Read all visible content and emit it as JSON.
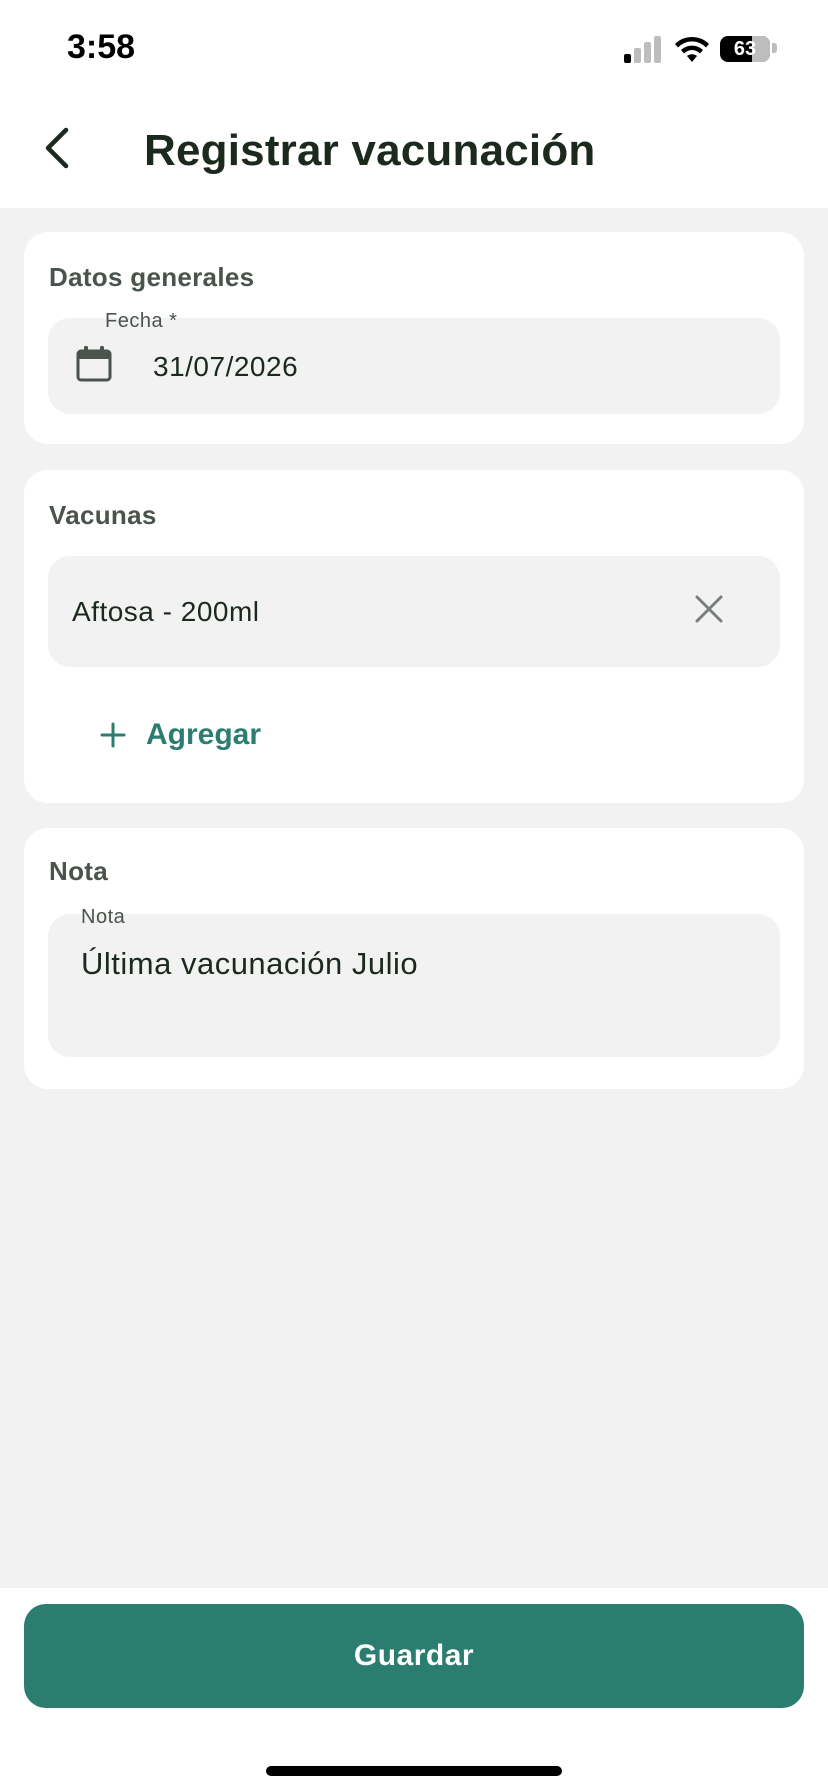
{
  "status_bar": {
    "time": "3:58",
    "battery_percent": "63",
    "battery_level": 0.63
  },
  "header": {
    "back_icon": "chevron-left-icon",
    "title": "Registrar vacunación"
  },
  "general_section": {
    "title": "Datos generales",
    "date_field": {
      "label": "Fecha *",
      "value": "31/07/2026",
      "icon": "calendar-icon"
    }
  },
  "vaccines_section": {
    "title": "Vacunas",
    "items": [
      {
        "label": "Aftosa - 200ml",
        "remove_icon": "close-icon"
      }
    ],
    "add_label": "Agregar",
    "add_icon": "plus-icon"
  },
  "note_section": {
    "title": "Nota",
    "note_field": {
      "label": "Nota",
      "value": "Última vacunación Julio"
    }
  },
  "footer": {
    "save_label": "Guardar"
  },
  "colors": {
    "accent": "#2a7d6f",
    "background": "#f2f2f2",
    "card": "#ffffff",
    "field": "#f2f2f2",
    "title_text": "#1c2a1e",
    "section_text": "#4a544c"
  }
}
